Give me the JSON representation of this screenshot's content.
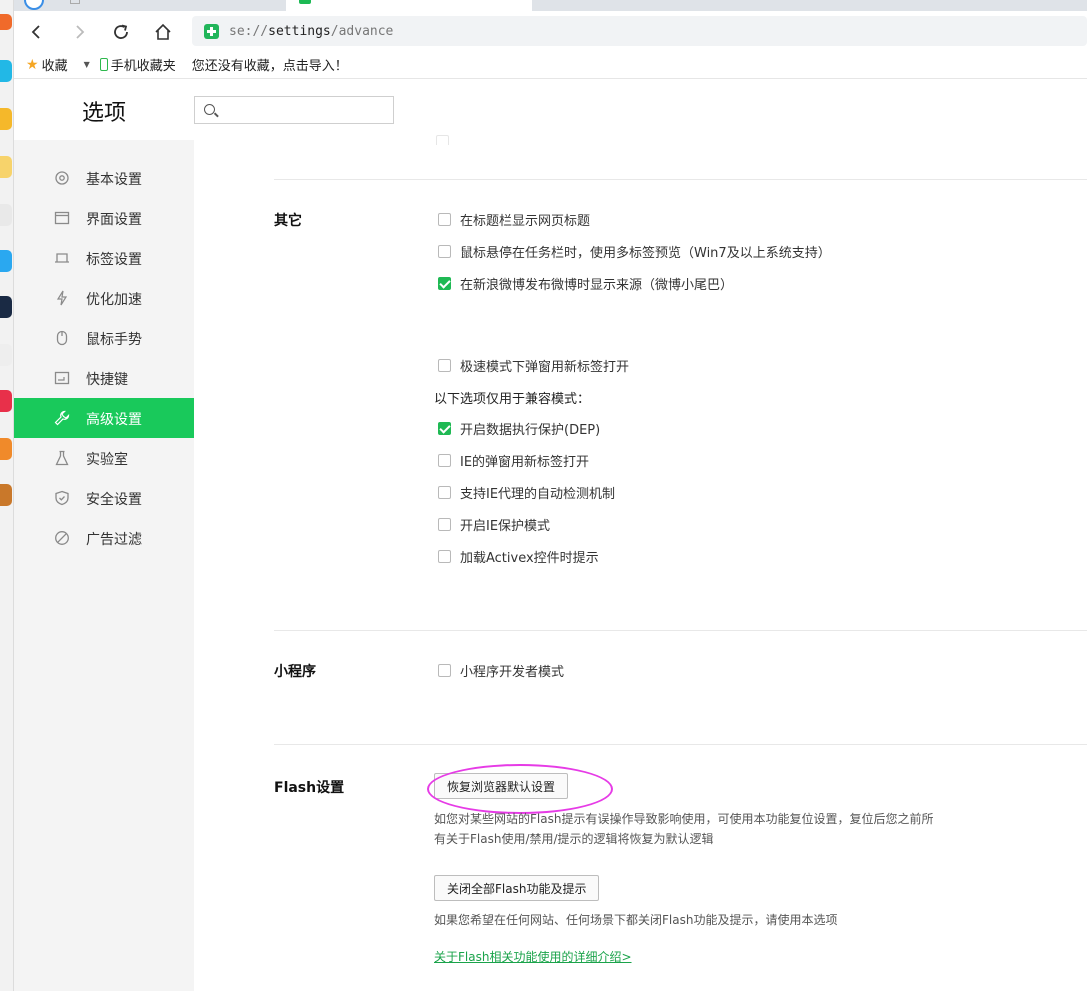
{
  "browser": {
    "address_scheme": "se://",
    "address_host": "settings",
    "address_path": "/advance"
  },
  "bookmarks": {
    "favorites_label": "收藏",
    "mobile_label": "手机收藏夹",
    "import_hint": "您还没有收藏，点击导入！"
  },
  "settings": {
    "title": "选项",
    "search_placeholder": ""
  },
  "sidebar": {
    "items": [
      {
        "label": "基本设置",
        "icon": "gear-icon"
      },
      {
        "label": "界面设置",
        "icon": "window-icon"
      },
      {
        "label": "标签设置",
        "icon": "tab-icon"
      },
      {
        "label": "优化加速",
        "icon": "lightning-icon"
      },
      {
        "label": "鼠标手势",
        "icon": "mouse-icon"
      },
      {
        "label": "快捷键",
        "icon": "keyboard-icon"
      },
      {
        "label": "高级设置",
        "icon": "wrench-icon"
      },
      {
        "label": "实验室",
        "icon": "flask-icon"
      },
      {
        "label": "安全设置",
        "icon": "shield-icon"
      },
      {
        "label": "广告过滤",
        "icon": "block-icon"
      }
    ],
    "active_index": 6
  },
  "other": {
    "title": "其它",
    "options": [
      {
        "label": "在标题栏显示网页标题",
        "checked": false
      },
      {
        "label": "鼠标悬停在任务栏时，使用多标签预览（Win7及以上系统支持）",
        "checked": false
      },
      {
        "label": "在新浪微博发布微博时显示来源（微博小尾巴）",
        "checked": true
      },
      {
        "label": "极速模式下弹窗用新标签打开",
        "checked": false
      }
    ],
    "compat_heading": "以下选项仅用于兼容模式：",
    "compat_options": [
      {
        "label": "开启数据执行保护(DEP)",
        "checked": true
      },
      {
        "label": "IE的弹窗用新标签打开",
        "checked": false
      },
      {
        "label": "支持IE代理的自动检测机制",
        "checked": false
      },
      {
        "label": "开启IE保护模式",
        "checked": false
      },
      {
        "label": "加载Activex控件时提示",
        "checked": false
      }
    ]
  },
  "mini_program": {
    "title": "小程序",
    "option": {
      "label": "小程序开发者模式",
      "checked": false
    }
  },
  "flash": {
    "title": "Flash设置",
    "restore_button": "恢复浏览器默认设置",
    "restore_desc_line1": "如您对某些网站的Flash提示有误操作导致影响使用，可使用本功能复位设置，复位后您之前所",
    "restore_desc_line2": "有关于Flash使用/禁用/提示的逻辑将恢复为默认逻辑",
    "disable_button": "关闭全部Flash功能及提示",
    "disable_desc": "如果您希望在任何网站、任何场景下都关闭Flash功能及提示，请使用本选项",
    "detail_link": "关于Flash相关功能使用的详细介绍>"
  },
  "colors": {
    "accent": "#19c95b",
    "annotation": "#e63be6"
  }
}
